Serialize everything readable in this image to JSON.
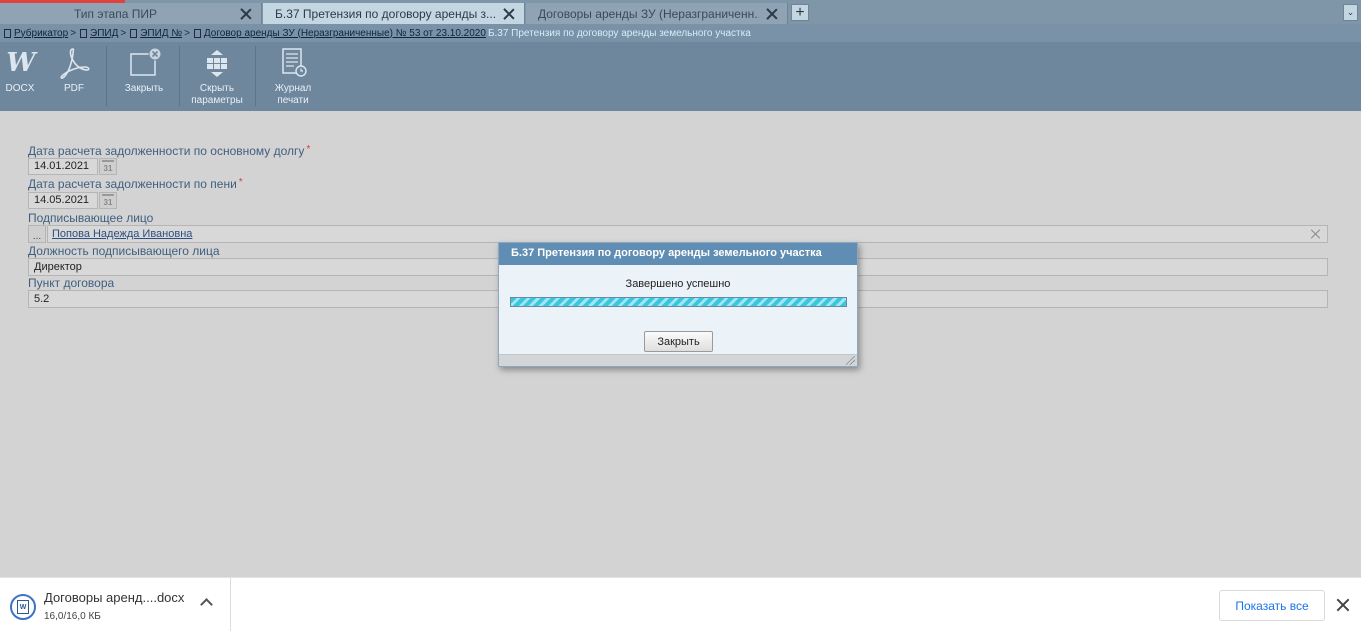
{
  "tabs": [
    {
      "label": "Тип этапа ПИР",
      "active": false
    },
    {
      "label": "Б.37 Претензия по договору аренды з...",
      "active": true
    },
    {
      "label": "Договоры аренды ЗУ (Неразграниченн...",
      "active": false
    }
  ],
  "tab_add_label": "+",
  "tab_menu_label": "⌄",
  "breadcrumb": {
    "items": [
      "Рубрикатор",
      "ЭПИД",
      "ЭПИД №",
      "Договор аренды ЗУ (Неразграниченные) № 53 от 23.10.2020"
    ],
    "separator": ">",
    "current": "Б.37 Претензия по договору аренды земельного участка"
  },
  "toolbar": {
    "docx_label": "DOCX",
    "docx_icon_text": "W",
    "pdf_label": "PDF",
    "close_label": "Закрыть",
    "hide_params_label_1": "Скрыть",
    "hide_params_label_2": "параметры",
    "print_log_label_1": "Журнал",
    "print_log_label_2": "печати"
  },
  "form": {
    "debt_date_label": "Дата расчета задолженности по основному долгу",
    "debt_date_value": "14.01.2021",
    "penalty_date_label": "Дата расчета задолженности по пени",
    "penalty_date_value": "14.05.2021",
    "signer_label": "Подписывающее лицо",
    "signer_value": "Попова Надежда Ивановна",
    "signer_position_label": "Должность подписывающего лица",
    "signer_position_value": "Директор",
    "contract_clause_label": "Пункт договора",
    "contract_clause_value": "5.2",
    "required_mark": "*",
    "calendar_text": "31",
    "lookup_text": "..."
  },
  "modal": {
    "title": "Б.37 Претензия по договору аренды земельного участка",
    "message": "Завершено успешно",
    "progress": 1.0,
    "close_button": "Закрыть"
  },
  "download_bar": {
    "file_name": "Договоры аренд....docx",
    "file_size": "16,0/16,0 КБ",
    "file_icon_text": "W",
    "show_all_label": "Показать все"
  },
  "colors": {
    "accent": "#5f8db3",
    "progress": "#3bc6df",
    "link": "#1a73e8",
    "required": "#d23c3c"
  }
}
